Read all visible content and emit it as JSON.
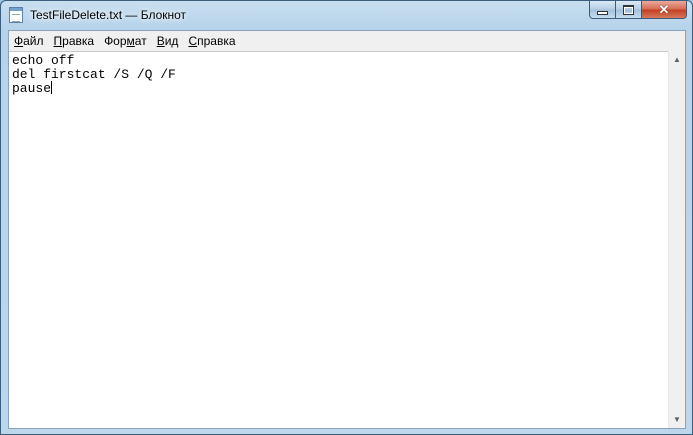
{
  "window": {
    "title": "TestFileDelete.txt — Блокнот"
  },
  "menu": [
    {
      "label": "Файл",
      "accel": "Ф",
      "rest": "айл"
    },
    {
      "label": "Правка",
      "accel": "П",
      "rest": "равка"
    },
    {
      "label": "Формат",
      "accel": "",
      "pre": "Фор",
      "acc2": "м",
      "post": "ат"
    },
    {
      "label": "Вид",
      "accel": "В",
      "rest": "ид"
    },
    {
      "label": "Справка",
      "accel": "С",
      "rest": "правка"
    }
  ],
  "editor": {
    "lines": [
      "echo off",
      "del firstcat /S /Q /F",
      "pause"
    ]
  },
  "icons": {
    "app": "notepad-icon",
    "minimize": "minimize-icon",
    "maximize": "maximize-icon",
    "close": "close-icon"
  }
}
